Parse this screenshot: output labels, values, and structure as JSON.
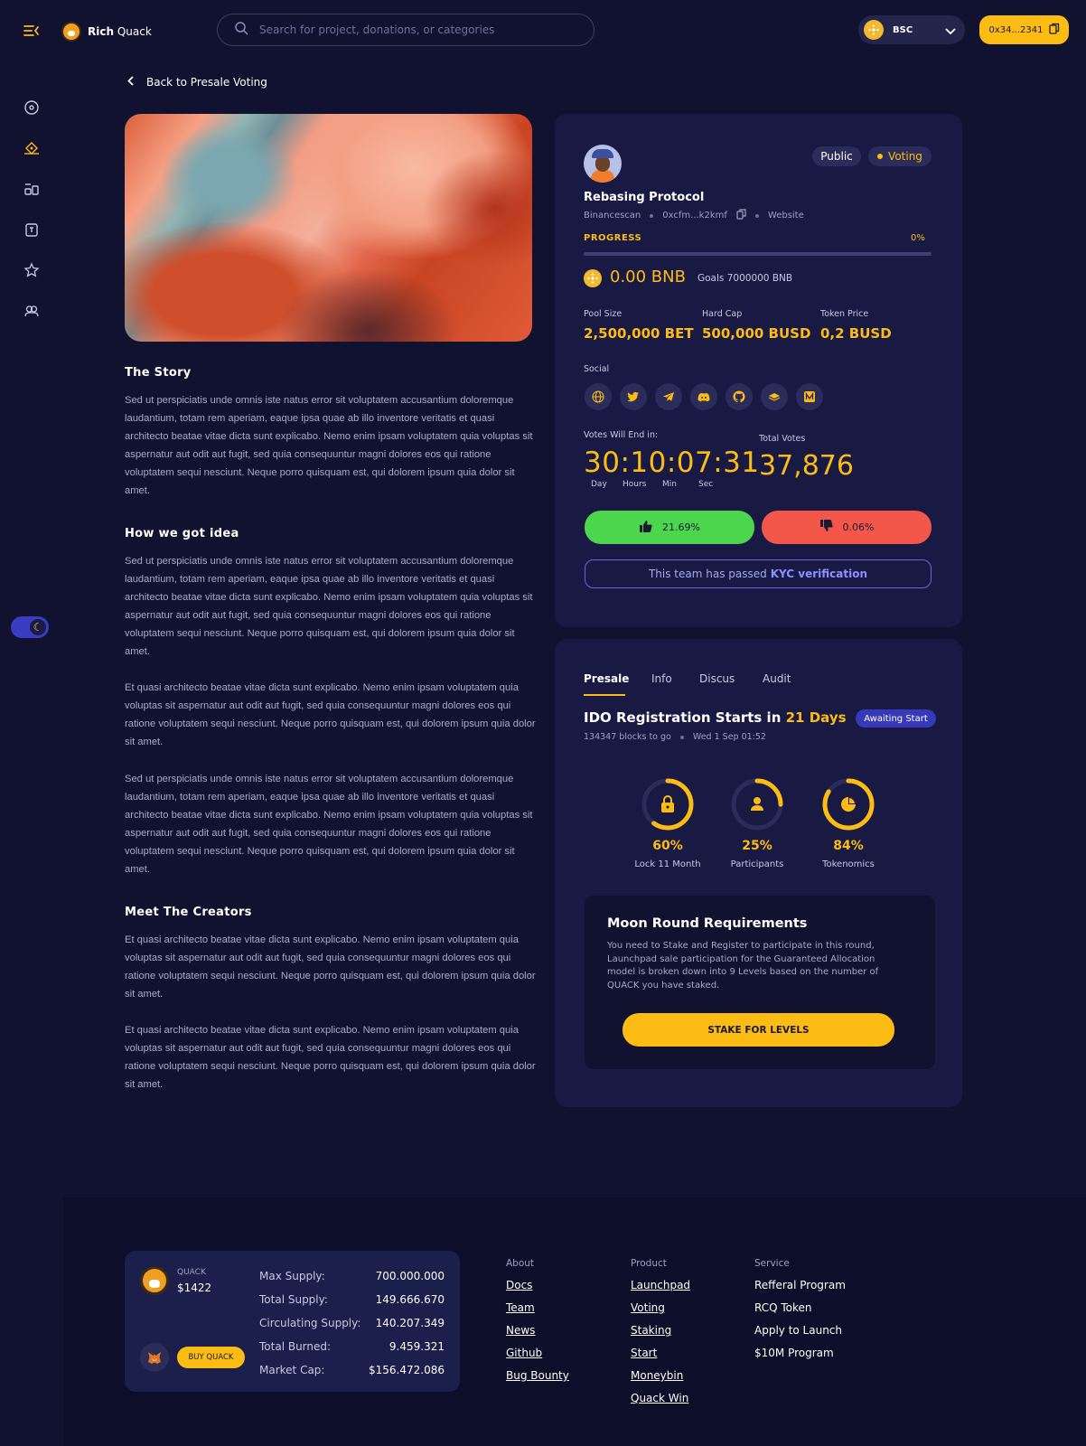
{
  "header": {
    "brand_bold": "Rich",
    "brand_rest": "Quack",
    "search_placeholder": "Search for project, donations, or categories",
    "chain": "BSC",
    "wallet": "0x34...2341"
  },
  "back_label": "Back to Presale Voting",
  "story": {
    "h1": "The Story",
    "p1": "Sed ut perspiciatis unde omnis iste natus error sit voluptatem accusantium doloremque laudantium, totam rem aperiam, eaque ipsa quae ab illo inventore veritatis et quasi architecto beatae vitae dicta sunt explicabo. Nemo enim ipsam voluptatem quia voluptas sit aspernatur aut odit aut fugit, sed quia consequuntur magni dolores eos qui ratione voluptatem sequi nesciunt. Neque porro quisquam est, qui dolorem ipsum quia dolor sit amet.",
    "h2": "How we got idea",
    "p2": "Sed ut perspiciatis unde omnis iste natus error sit voluptatem accusantium doloremque laudantium, totam rem aperiam, eaque ipsa quae ab illo inventore veritatis et quasi architecto beatae vitae dicta sunt explicabo. Nemo enim ipsam voluptatem quia voluptas sit aspernatur aut odit aut fugit, sed quia consequuntur magni dolores eos qui ratione voluptatem sequi nesciunt. Neque porro quisquam est, qui dolorem ipsum quia dolor sit amet.",
    "p3": "Et quasi architecto beatae vitae dicta sunt explicabo. Nemo enim ipsam voluptatem quia voluptas sit aspernatur aut odit aut fugit, sed quia consequuntur magni dolores eos qui ratione voluptatem sequi nesciunt. Neque porro quisquam est, qui dolorem ipsum quia dolor sit amet.",
    "p4": "Sed ut perspiciatis unde omnis iste natus error sit voluptatem accusantium doloremque laudantium, totam rem aperiam, eaque ipsa quae ab illo inventore veritatis et quasi architecto beatae vitae dicta sunt explicabo. Nemo enim ipsam voluptatem quia voluptas sit aspernatur aut odit aut fugit, sed quia consequuntur magni dolores eos qui ratione voluptatem sequi nesciunt. Neque porro quisquam est, qui dolorem ipsum quia dolor sit amet.",
    "h3": "Meet The Creators",
    "p5": "Et quasi architecto beatae vitae dicta sunt explicabo. Nemo enim ipsam voluptatem quia voluptas sit aspernatur aut odit aut fugit, sed quia consequuntur magni dolores eos qui ratione voluptatem sequi nesciunt. Neque porro quisquam est, qui dolorem ipsum quia dolor sit amet.",
    "p6": "Et quasi architecto beatae vitae dicta sunt explicabo. Nemo enim ipsam voluptatem quia voluptas sit aspernatur aut odit aut fugit, sed quia consequuntur magni dolores eos qui ratione voluptatem sequi nesciunt. Neque porro quisquam est, qui dolorem ipsum quia dolor sit amet."
  },
  "project": {
    "badge_public": "Public",
    "badge_voting": "Voting",
    "title": "Rebasing Protocol",
    "explorer": "Binancescan",
    "address": "0xcfm...k2kmf",
    "website": "Website",
    "progress_label": "PROGRESS",
    "progress_pct": "0%",
    "progress_value": 0,
    "raised": "0.00 BNB",
    "goal": "Goals 7000000 BNB",
    "pool_size_label": "Pool Size",
    "pool_size": "2,500,000 BET",
    "hard_cap_label": "Hard Cap",
    "hard_cap": "500,000 BUSD",
    "token_price_label": "Token Price",
    "token_price": "0,2 BUSD",
    "social_label": "Social",
    "socials": [
      "globe-icon",
      "twitter-icon",
      "telegram-icon",
      "discord-icon",
      "github-icon",
      "gitbook-icon",
      "medium-icon"
    ],
    "votes_end_label": "Votes Will End in:",
    "countdown": "30:10:07:31",
    "units": [
      "Day",
      "Hours",
      "Min",
      "Sec"
    ],
    "total_votes_label": "Total Votes",
    "total_votes": "37,876",
    "up_pct": "21.69%",
    "down_pct": "0.06%",
    "kyc_text": "This team has passed",
    "kyc_bold": "KYC verification"
  },
  "presale": {
    "tabs": [
      "Presale",
      "Info",
      "Discus",
      "Audit"
    ],
    "title_prefix": "IDO Registration Starts in",
    "title_highlight": "21 Days",
    "status": "Awaiting Start",
    "blocks": "134347 blocks to go",
    "date": "Wed 1 Sep 01:52",
    "rings": [
      {
        "pct": "60%",
        "value": 0.6,
        "label": "Lock 11 Month",
        "icon": "lock-icon"
      },
      {
        "pct": "25%",
        "value": 0.25,
        "label": "Participants",
        "icon": "user-icon"
      },
      {
        "pct": "84%",
        "value": 0.84,
        "label": "Tokenomics",
        "icon": "pie-icon"
      }
    ],
    "moon_title": "Moon Round Requirements",
    "moon_desc": "You need to Stake and Register to participate in this round, Launchpad sale participation for the Guaranteed Allocation model is broken down into 9 Levels based on the number of QUACK you have staked.",
    "stake_button": "STAKE FOR LEVELS"
  },
  "footer": {
    "token_name": "QUACK",
    "token_price": "$1422",
    "buy_button": "BUY QUACK",
    "supply": [
      {
        "label": "Max Supply:",
        "value": "700.000.000"
      },
      {
        "label": "Total Supply:",
        "value": "149.666.670"
      },
      {
        "label": "Circulating Supply:",
        "value": "140.207.349"
      },
      {
        "label": "Total Burned:",
        "value": "9.459.321"
      },
      {
        "label": "Market Cap:",
        "value": "$156.472.086"
      }
    ],
    "about_title": "About",
    "about": [
      "Docs",
      "Team",
      "News",
      "Github",
      "Bug Bounty"
    ],
    "product_title": "Product",
    "product": [
      "Launchpad",
      "Voting",
      "Staking",
      "Start",
      "Moneybin",
      "Quack Win"
    ],
    "service_title": "Service",
    "service": [
      "Refferal Program",
      "RCQ Token",
      "Apply to Launch",
      "$10M Program"
    ]
  },
  "colors": {
    "accent": "#fcbc14",
    "bg": "#111230",
    "card": "#181a44",
    "up": "#4bd64e",
    "down": "#f2574a"
  }
}
